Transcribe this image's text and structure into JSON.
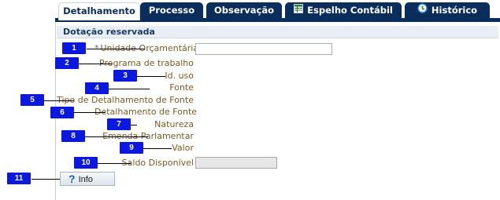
{
  "tabs": [
    {
      "label": "Detalhamento",
      "active": true
    },
    {
      "label": "Processo",
      "active": false
    },
    {
      "label": "Observação",
      "active": false
    },
    {
      "label": "Espelho Contábil",
      "active": false,
      "icon": "spreadsheet-icon"
    },
    {
      "label": "Histórico",
      "active": false,
      "icon": "history-icon"
    }
  ],
  "section": {
    "title": "Dotação reservada"
  },
  "fields": [
    {
      "number": "1",
      "label": "Unidade Orçamentária",
      "required_mark": "*",
      "input_value": ""
    },
    {
      "number": "2",
      "label": "Programa de trabalho"
    },
    {
      "number": "3",
      "label": "Id. uso"
    },
    {
      "number": "4",
      "label": "Fonte"
    },
    {
      "number": "5",
      "label": "Tipo de Detalhamento de Fonte"
    },
    {
      "number": "6",
      "label": "Detalhamento de Fonte"
    },
    {
      "number": "7",
      "label": "Natureza"
    },
    {
      "number": "8",
      "label": "Emenda Parlamentar"
    },
    {
      "number": "9",
      "label": "Valor"
    },
    {
      "number": "10",
      "label": "Saldo Disponível",
      "input_value": ""
    }
  ],
  "info_button": {
    "number": "11",
    "label": "Info",
    "icon": "question-mark-icon"
  },
  "colors": {
    "tab_bg": "#0a2d5c",
    "badge": "#0b18e0",
    "label_text": "#7a5a22",
    "section_text": "#1b3a66"
  }
}
